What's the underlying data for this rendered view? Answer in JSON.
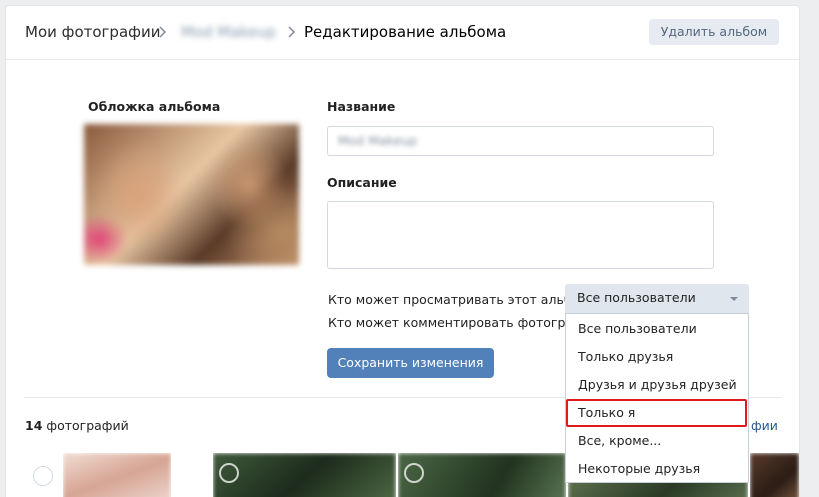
{
  "breadcrumb": {
    "root": "Мои фотографии",
    "album": "Mod Makeup",
    "current": "Редактирование альбома"
  },
  "header": {
    "delete_button": "Удалить альбом"
  },
  "cover": {
    "label": "Обложка альбома"
  },
  "form": {
    "name_label": "Название",
    "name_value": "Mod Makeup",
    "description_label": "Описание",
    "description_value": "",
    "view_privacy_label": "Кто может просматривать этот альбом?",
    "comment_privacy_label": "Кто может комментировать фотографии?",
    "privacy_selected": "Все пользователи",
    "privacy_options": [
      "Все пользователи",
      "Только друзья",
      "Друзья и друзья друзей",
      "Только я",
      "Все, кроме...",
      "Некоторые друзья"
    ],
    "highlighted_option": "Только я",
    "save_button": "Сохранить изменения"
  },
  "photos": {
    "count": "14",
    "count_label": " фотографий",
    "link_fragment": "фии"
  },
  "colors": {
    "accent": "#5181b8",
    "highlight": "#e0191f",
    "link": "#2a5885"
  }
}
